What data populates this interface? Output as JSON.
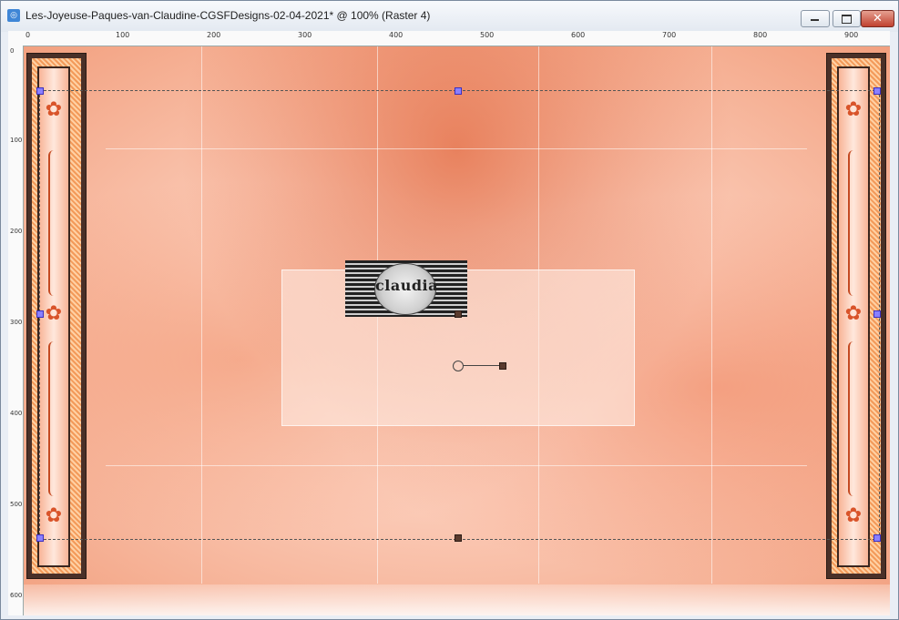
{
  "window": {
    "title": "Les-Joyeuse-Paques-van-Claudine-CGSFDesigns-02-04-2021* @ 100% (Raster 4)",
    "controls": {
      "minimize_glyph": "",
      "maximize_glyph": "",
      "close_glyph": "✕"
    }
  },
  "ruler_top": {
    "labels": [
      "0",
      "100",
      "200",
      "300",
      "400",
      "500",
      "600",
      "700",
      "800",
      "900"
    ]
  },
  "ruler_left": {
    "labels": [
      "0",
      "100",
      "200",
      "300",
      "400",
      "500",
      "600"
    ]
  },
  "canvas": {
    "logo_text": "claudia",
    "accent_colors": {
      "peach": "#f2a07f",
      "terracotta": "#d9542a",
      "frame_brown": "#4a3028",
      "selection_handle": "#8a80ff"
    }
  }
}
